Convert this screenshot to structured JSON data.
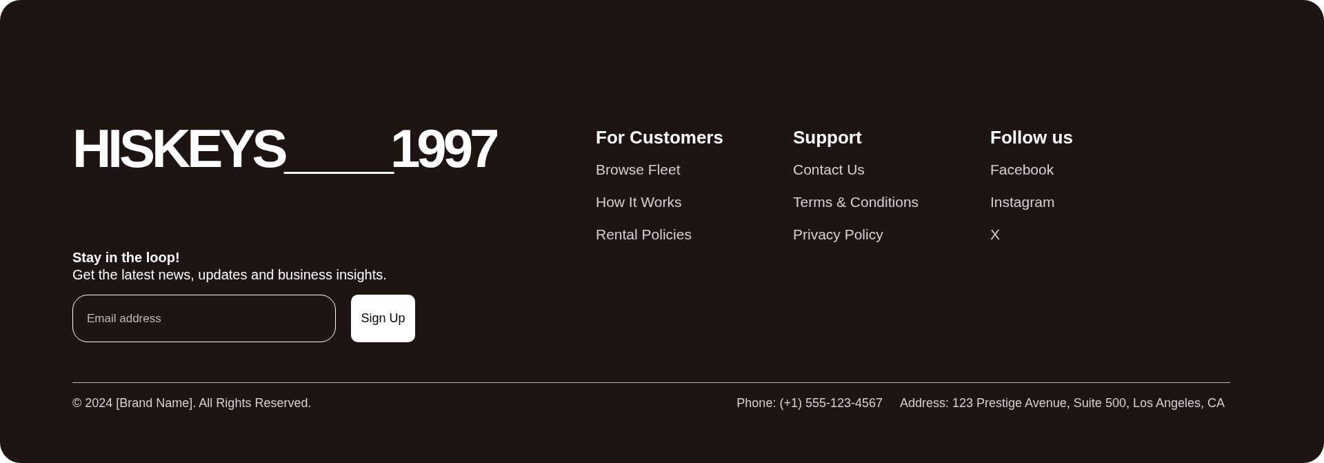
{
  "brand": {
    "logo": "HISKEYS____1997"
  },
  "newsletter": {
    "title": "Stay in the loop!",
    "subtitle": "Get the latest news, updates and business insights.",
    "email": {
      "placeholder": "Email address"
    },
    "button": "Sign Up"
  },
  "columns": [
    {
      "title": "For Customers",
      "links": [
        "Browse Fleet",
        "How It Works",
        "Rental Policies"
      ]
    },
    {
      "title": "Support",
      "links": [
        "Contact Us",
        "Terms & Conditions",
        "Privacy Policy"
      ]
    },
    {
      "title": "Follow us",
      "links": [
        "Facebook",
        "Instagram",
        "X"
      ]
    }
  ],
  "bottom_bar": {
    "copyright": "© 2024 [Brand Name]. All Rights Reserved.",
    "phone": "Phone: (+1) 555-123-4567",
    "address": "Address: 123 Prestige Avenue, Suite 500, Los Angeles, CA"
  }
}
